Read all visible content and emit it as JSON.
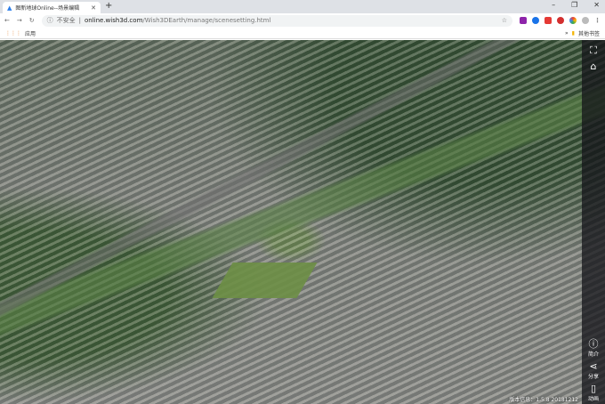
{
  "browser": {
    "tab_title": "图新地球Online--场景编辑",
    "url_host": "online.wish3d.com",
    "url_path": "/Wish3DEarth/manage/scenesetting.html",
    "security_label": "不安全",
    "bookmarks_apps": "应用",
    "bookmarks_other": "其他书签"
  },
  "toolbar": {
    "items": [
      {
        "icon": "fullscreen-icon"
      },
      {
        "icon": "home-icon"
      }
    ]
  },
  "side_buttons": [
    {
      "icon": "info-icon",
      "label": "简介"
    },
    {
      "icon": "share-icon",
      "label": "分享"
    },
    {
      "icon": "mouse-icon",
      "label": "动画"
    }
  ],
  "status": {
    "text": "版本信息：1.5.8 20181212"
  },
  "colors": {
    "sidebar": "#141419",
    "accent": "#2b7de9"
  }
}
